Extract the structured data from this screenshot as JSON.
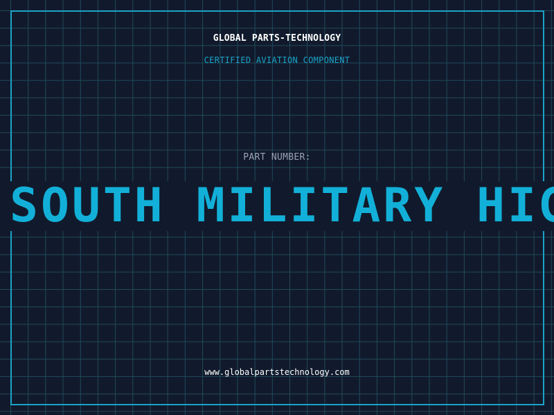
{
  "header": {
    "brand": "GLOBAL PARTS-TECHNOLOGY",
    "tagline": "CERTIFIED AVIATION COMPONENT"
  },
  "part": {
    "label": "PART NUMBER:",
    "value": "SOUTH MILITARY HIG"
  },
  "footer": {
    "url": "www.globalpartstechnology.com"
  },
  "colors": {
    "background": "#111a2c",
    "grid": "#1f4a5c",
    "accent": "#1ba3c8",
    "part_number": "#12b0d8",
    "label": "#9aa4b4",
    "text": "#ffffff"
  }
}
